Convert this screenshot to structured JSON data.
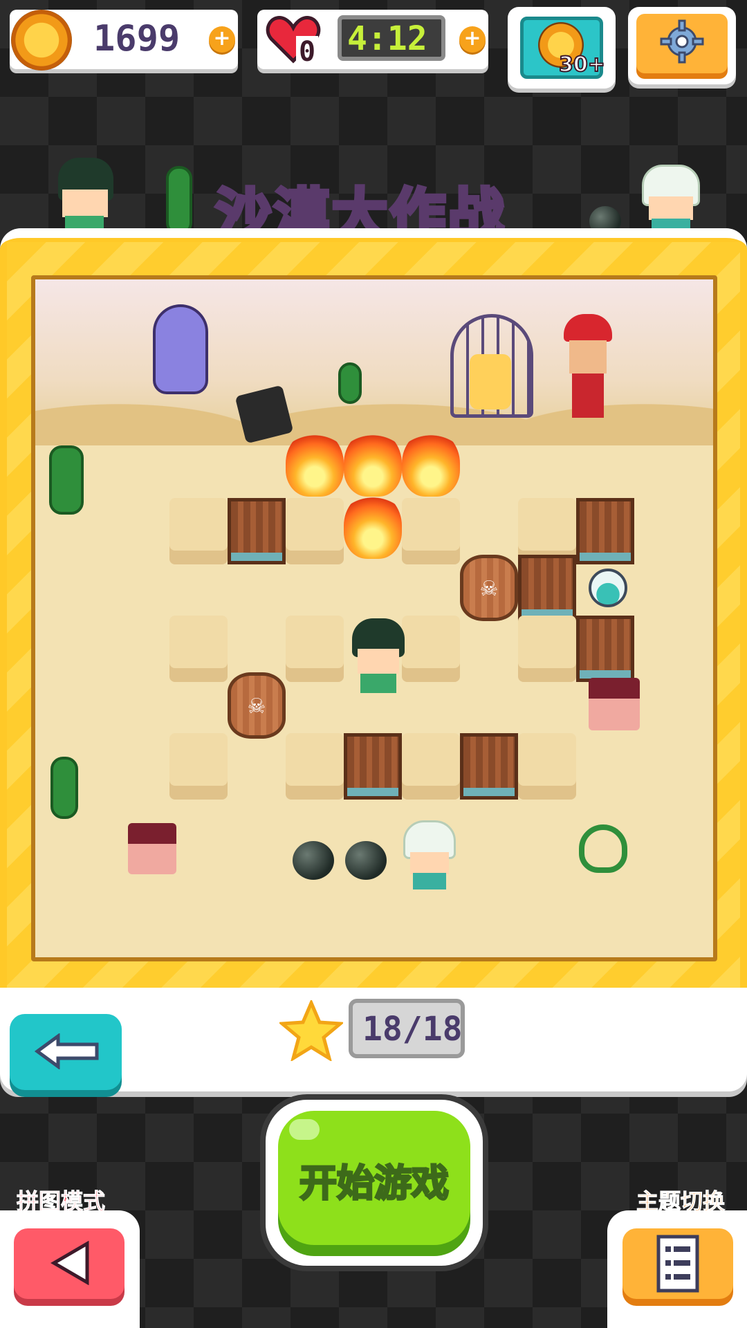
{
  "hud": {
    "coins": "1699",
    "lives": "0",
    "timer": "4:12",
    "reward_badge": "30+"
  },
  "title": "沙漠大作战",
  "progress": {
    "stars": "18/18"
  },
  "buttons": {
    "start": "开始游戏",
    "puzzle_mode_label": "拼图模式",
    "theme_switch_label": "主题切换"
  },
  "icons": {
    "coin": "coin-icon",
    "heart": "heart-icon",
    "video_reward": "video-reward-icon",
    "settings": "gear-icon",
    "star": "star-icon",
    "back": "arrow-left-icon",
    "puzzle": "triangle-left-icon",
    "theme": "list-icon"
  },
  "colors": {
    "accent_yellow": "#ffc928",
    "start_green": "#8ee01b",
    "back_teal": "#22c6c9",
    "puzzle_red": "#ff5a68",
    "theme_orange": "#ffb338"
  }
}
